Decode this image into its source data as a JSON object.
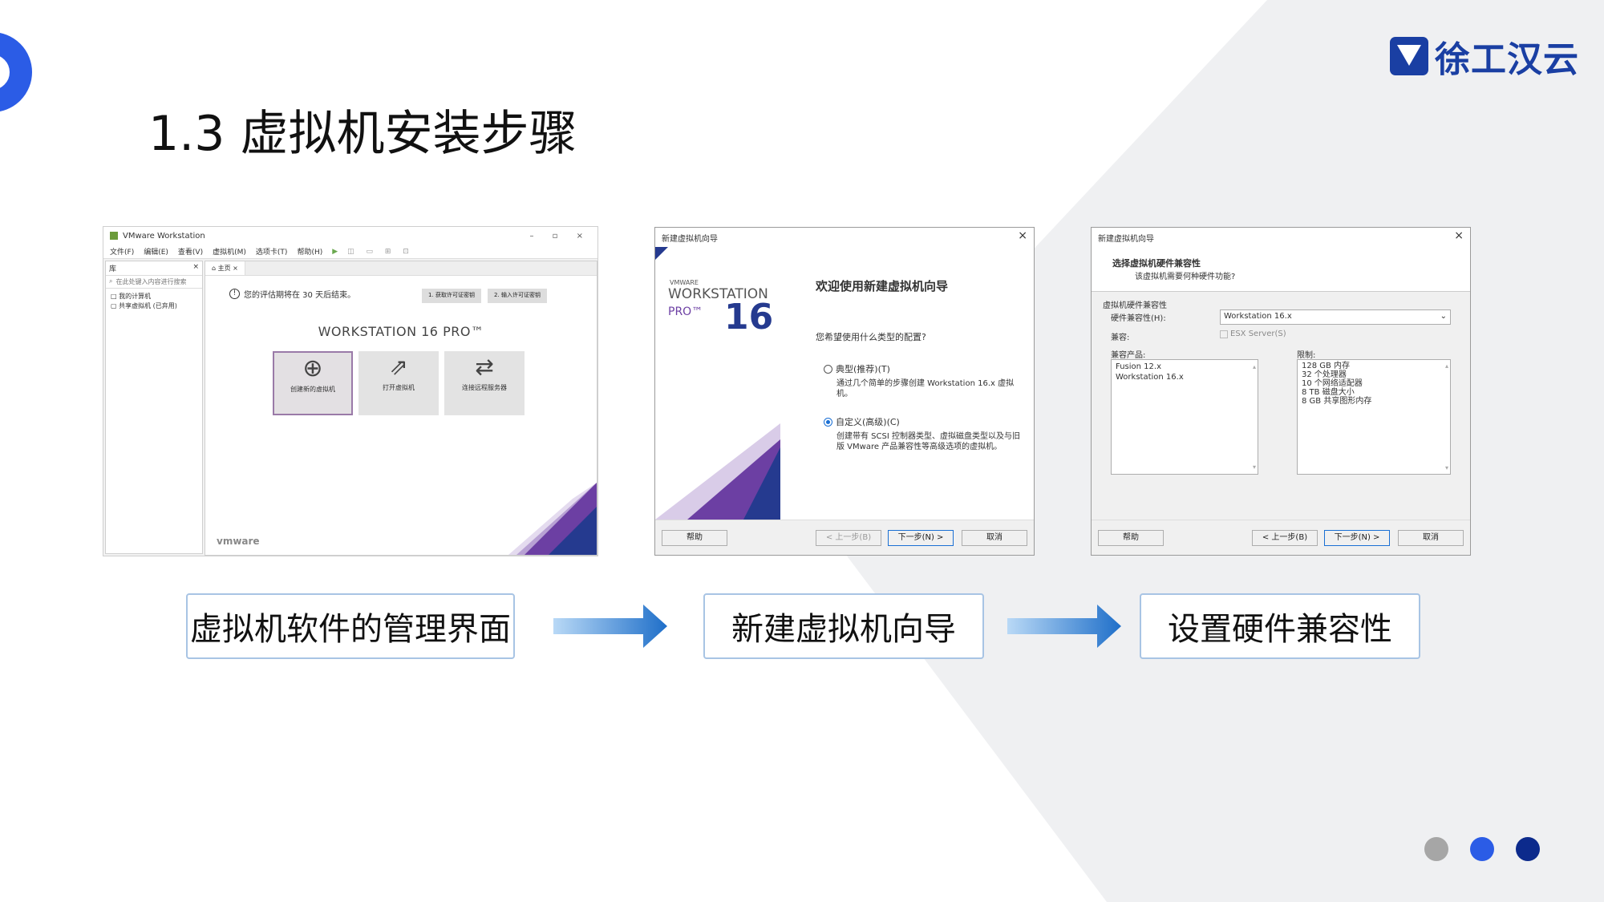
{
  "slide": {
    "title": "1.3 虚拟机安装步骤",
    "logo_text": "徐工汉云",
    "captions": [
      "虚拟机软件的管理界面",
      "新建虚拟机向导",
      "设置硬件兼容性"
    ]
  },
  "shot1": {
    "window_title": "VMware Workstation",
    "menu": [
      "文件(F)",
      "编辑(E)",
      "查看(V)",
      "虚拟机(M)",
      "选项卡(T)",
      "帮助(H)"
    ],
    "library_label": "库",
    "search_placeholder": "在此处键入内容进行搜索",
    "tree": [
      "我的计算机",
      "共享虚拟机 (已弃用)"
    ],
    "tab_label": "主页",
    "notice": "您的评估期将在 30 天后结束。",
    "license_buttons": [
      "1. 获取许可证密钥",
      "2. 输入许可证密钥"
    ],
    "product_name": "WORKSTATION 16 PRO™",
    "tiles": [
      "创建新的虚拟机",
      "打开虚拟机",
      "连接远程服务器"
    ],
    "brand": "vmware"
  },
  "shot2": {
    "window_title": "新建虚拟机向导",
    "brand_small": "VMWARE",
    "product_line": "WORKSTATION",
    "product_edition": "PRO™",
    "version": "16",
    "heading": "欢迎使用新建虚拟机向导",
    "question": "您希望使用什么类型的配置?",
    "option_typical": "典型(推荐)(T)",
    "option_typical_desc": "通过几个简单的步骤创建 Workstation 16.x 虚拟机。",
    "option_custom": "自定义(高级)(C)",
    "option_custom_desc": "创建带有 SCSI 控制器类型、虚拟磁盘类型以及与旧版 VMware 产品兼容性等高级选项的虚拟机。",
    "buttons": {
      "help": "帮助",
      "back": "< 上一步(B)",
      "next": "下一步(N) >",
      "cancel": "取消"
    }
  },
  "shot3": {
    "window_title": "新建虚拟机向导",
    "heading": "选择虚拟机硬件兼容性",
    "subheading": "该虚拟机需要何种硬件功能?",
    "section": "虚拟机硬件兼容性",
    "hw_label": "硬件兼容性(H):",
    "hw_value": "Workstation 16.x",
    "compat_label": "兼容:",
    "compat_value": "ESX Server(S)",
    "products_label": "兼容产品:",
    "products": [
      "Fusion 12.x",
      "Workstation 16.x"
    ],
    "limits_label": "限制:",
    "limits": [
      "128 GB 内存",
      "32 个处理器",
      "10 个网络适配器",
      "8 TB 磁盘大小",
      "8 GB 共享图形内存"
    ],
    "buttons": {
      "help": "帮助",
      "back": "< 上一步(B)",
      "next": "下一步(N) >",
      "cancel": "取消"
    }
  },
  "colors": {
    "accent": "#2b5ce6",
    "logo": "#1a3fa3",
    "dot_gray": "#a6a6a6",
    "dot_blue": "#2b5ce6",
    "dot_navy": "#0c2a8c"
  }
}
